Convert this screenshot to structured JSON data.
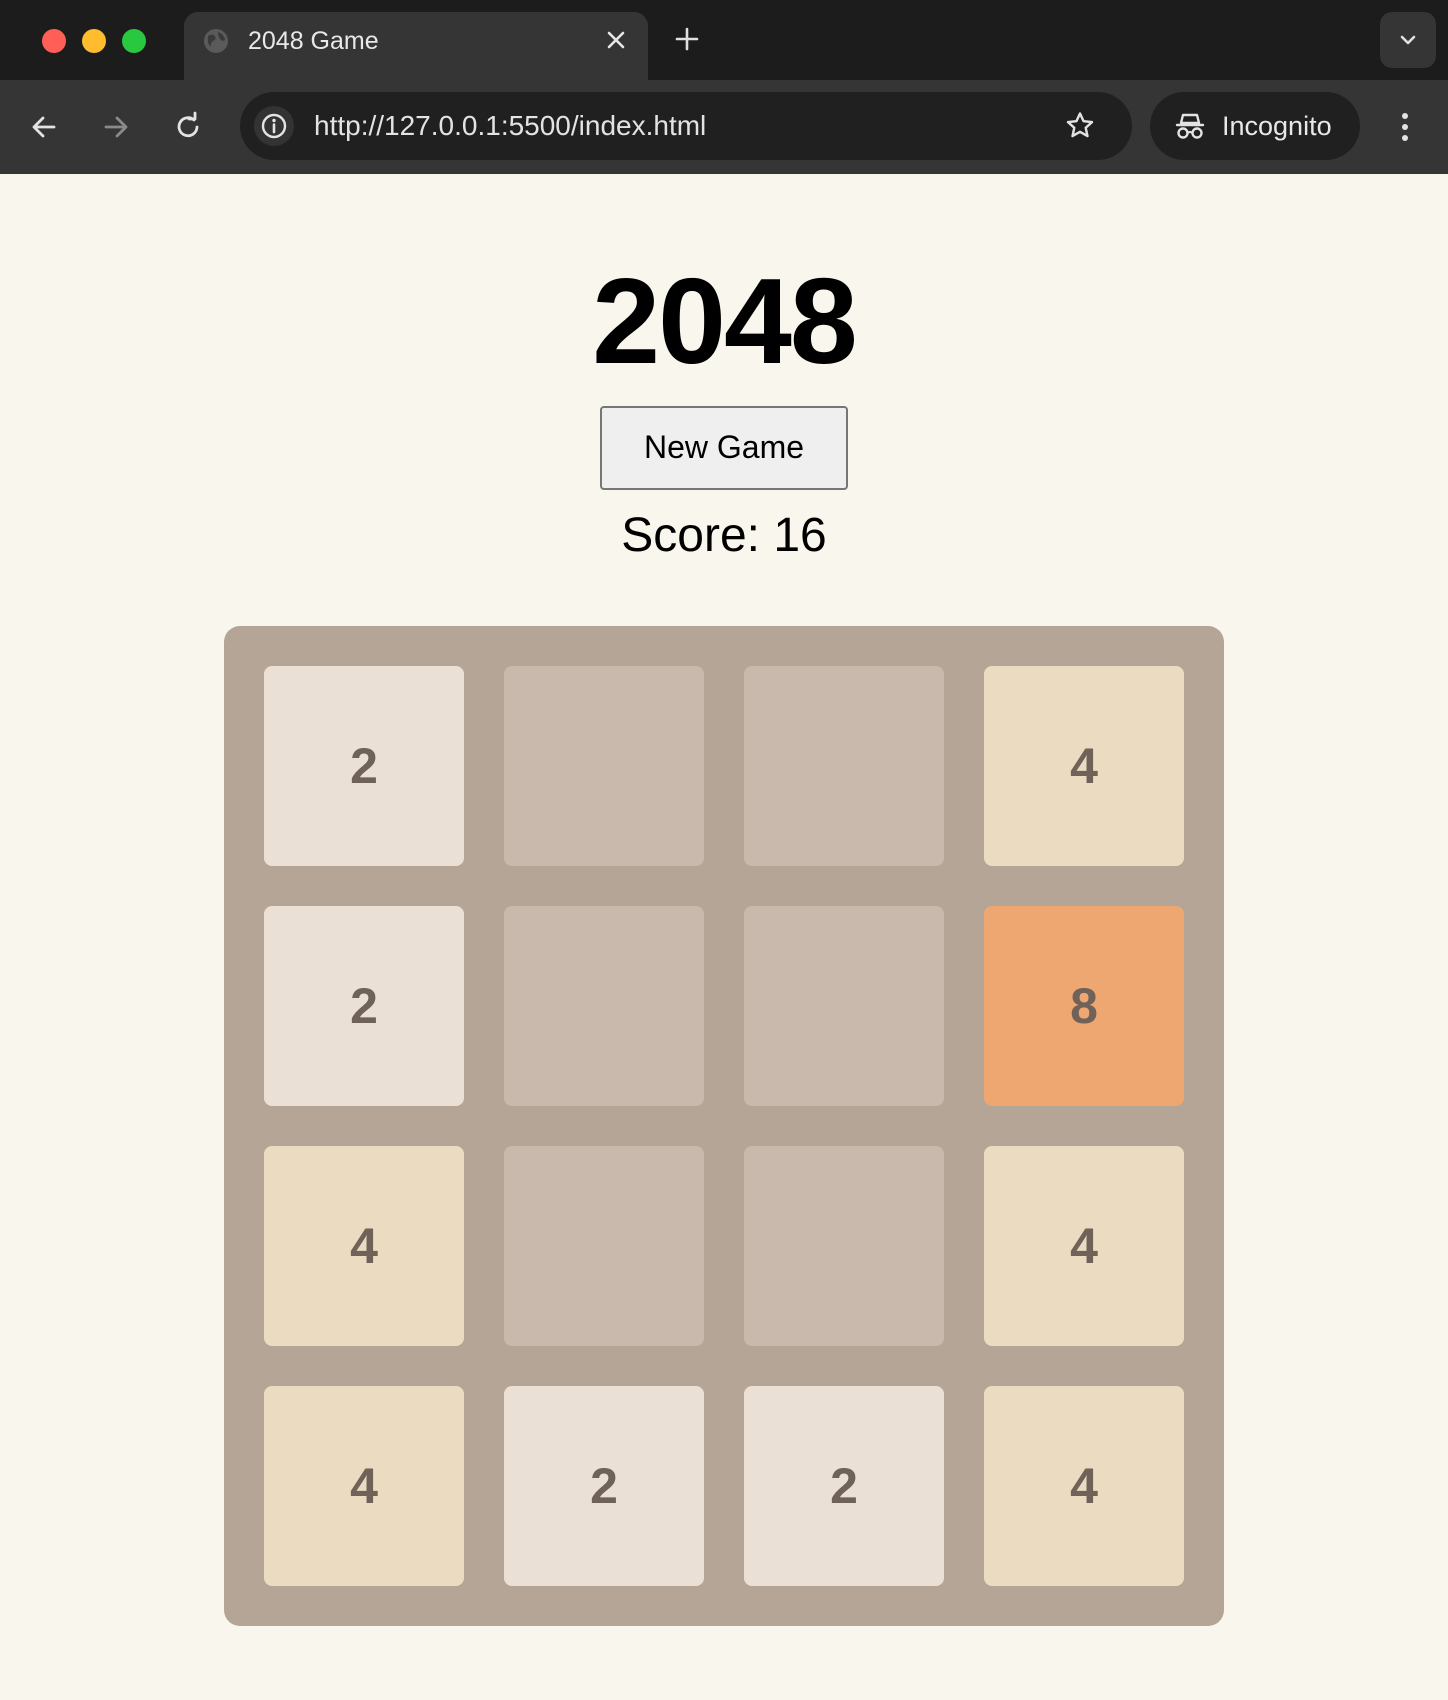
{
  "browser": {
    "tab_title": "2048 Game",
    "url": "http://127.0.0.1:5500/index.html",
    "incognito_label": "Incognito"
  },
  "game": {
    "title": "2048",
    "new_game_label": "New Game",
    "score_text": "Score: 16",
    "score": 16,
    "board": [
      [
        "2",
        "",
        "",
        "4"
      ],
      [
        "2",
        "",
        "",
        "8"
      ],
      [
        "4",
        "",
        "",
        "4"
      ],
      [
        "4",
        "2",
        "2",
        "4"
      ]
    ],
    "tile_colors": {
      "empty": "#c8b9ac",
      "2": "#eae0d6",
      "4": "#ebdbc0",
      "8": "#efa771"
    },
    "board_color": "#b4a596",
    "tile_text_color": "#6f6259"
  }
}
